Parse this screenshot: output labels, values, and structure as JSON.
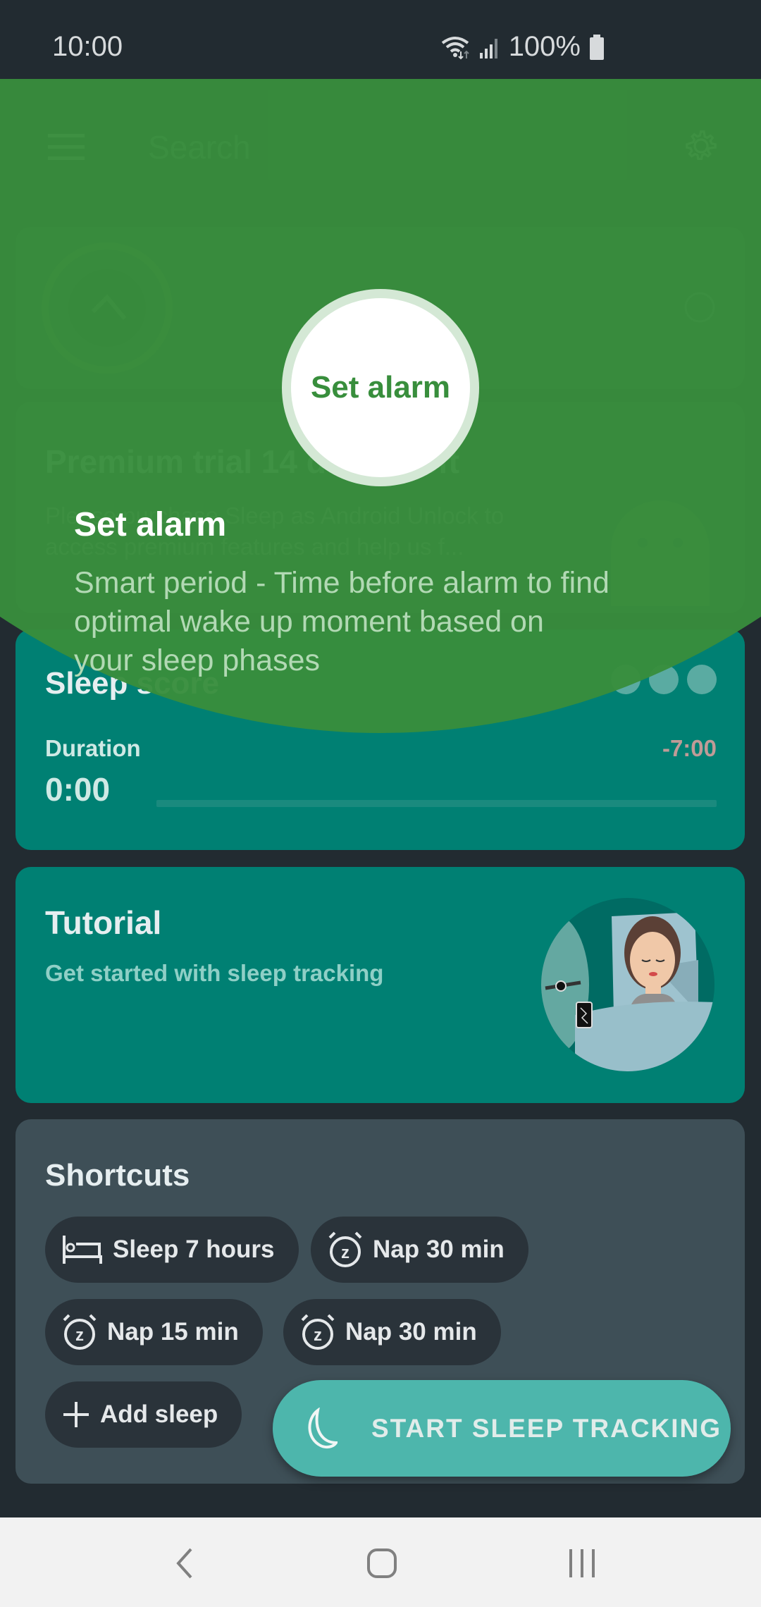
{
  "status_bar": {
    "time": "10:00",
    "battery": "100%",
    "icons": [
      "wifi-icon",
      "signal-icon",
      "battery-icon"
    ]
  },
  "toolbar": {
    "menu_icon": "menu-icon",
    "search_placeholder": "Search",
    "settings_icon": "gear-icon"
  },
  "premium_card": {
    "title": "Premium trial 14 day(s) left",
    "text": "Please purchase Sleep as Android Unlock to access premium features and help us f..."
  },
  "sleep_score_card": {
    "title": "Sleep score",
    "duration_label": "Duration",
    "duration_value": "0:00",
    "remaining": "-7:00",
    "progress_fraction": 0
  },
  "tutorial_card": {
    "title": "Tutorial",
    "subtitle": "Get started with sleep tracking"
  },
  "shortcuts_card": {
    "title": "Shortcuts",
    "chips": [
      {
        "label": "Sleep 7 hours",
        "icon": "bed-icon"
      },
      {
        "label": "Nap 30 min",
        "icon": "alarm-snooze-icon"
      },
      {
        "label": "Nap 15 min",
        "icon": "alarm-snooze-icon"
      },
      {
        "label": "Nap 30 min",
        "icon": "alarm-snooze-icon"
      },
      {
        "label": "Add sleep",
        "icon": "plus-icon"
      }
    ]
  },
  "fab": {
    "label": "START SLEEP TRACKING",
    "icon": "moon-icon"
  },
  "tutorial_overlay": {
    "target_label": "Set alarm",
    "title": "Set alarm",
    "description": "Smart period - Time before alarm to find optimal wake up moment based on your sleep phases",
    "color": "#388e3c"
  },
  "nav_bar": {
    "back": "back-icon",
    "home": "home-icon",
    "recents": "recents-icon"
  }
}
